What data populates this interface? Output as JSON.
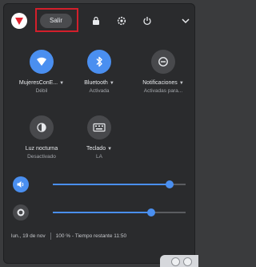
{
  "top_bar": {
    "sign_out_label": "Salir",
    "icons": [
      "lock-icon",
      "gear-icon",
      "power-icon",
      "chevron-down-icon"
    ]
  },
  "tiles": [
    {
      "label": "MujeresConE...",
      "sub": "Débil",
      "icon": "wifi-icon",
      "active": true
    },
    {
      "label": "Bluetooth",
      "sub": "Activada",
      "icon": "bluetooth-icon",
      "active": true
    },
    {
      "label": "Notificaciones",
      "sub": "Activadas para...",
      "icon": "notifications-icon",
      "active": false
    },
    {
      "label": "Luz nocturna",
      "sub": "Desactivado",
      "icon": "night-light-icon",
      "active": false
    },
    {
      "label": "Teclado",
      "sub": "LA",
      "icon": "keyboard-icon",
      "active": false
    }
  ],
  "sliders": {
    "volume": {
      "icon": "volume-icon",
      "value_percent": 88
    },
    "brightness": {
      "icon": "brightness-icon",
      "value_percent": 74
    }
  },
  "footer": {
    "date": "lun., 19 de nov",
    "battery": "100 % - Tiempo restante 11:50"
  },
  "colors": {
    "accent": "#4a8ff0",
    "highlight_border": "#d21f2b",
    "panel": "#2a2b2d"
  }
}
